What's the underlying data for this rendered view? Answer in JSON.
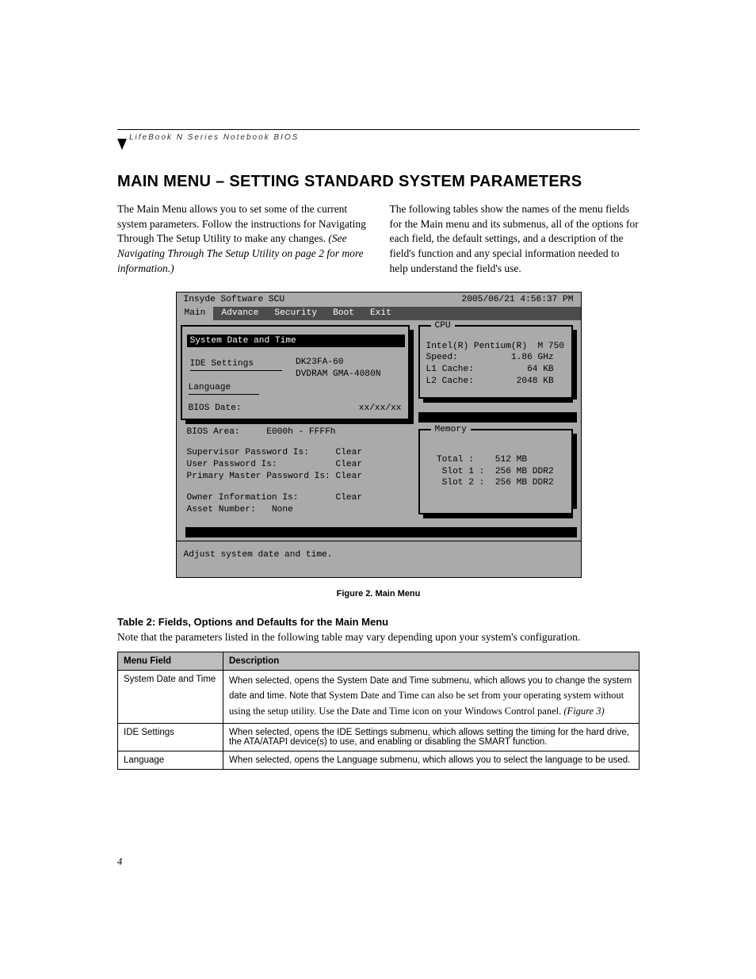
{
  "header": {
    "running_head": "LifeBook N Series Notebook BIOS"
  },
  "title": "MAIN MENU – SETTING STANDARD SYSTEM PARAMETERS",
  "col_left": {
    "p1": "The Main Menu allows you to set some of the current system parameters. Follow the instructions for Navigating Through The Setup Utility to make any changes.",
    "p2": "(See Navigating Through The Setup Utility on page 2 for more information.)"
  },
  "col_right": {
    "p1": "The following tables show the names of the menu fields for the Main menu and its submenus, all of the options for each field, the default settings, and a description of the field's function and any special information needed to help understand the field's use."
  },
  "bios": {
    "title": "Insyde Software SCU",
    "datetime": "2005/06/21  4:56:37  PM",
    "menu": [
      "Main",
      "Advance",
      "Security",
      "Boot",
      "Exit"
    ],
    "left": {
      "item_selected": "System Date and Time",
      "item_ide": "IDE Settings",
      "ide_dev1": "DK23FA-60",
      "ide_dev2": "DVDRAM GMA-4080N",
      "item_lang": "Language",
      "bios_date_lbl": "BIOS Date:",
      "bios_date_val": "xx/xx/xx",
      "bios_area_lbl": "BIOS Area:",
      "bios_area_val": "E000h - FFFFh",
      "supv_lbl": "Supervisor Password Is:",
      "supv_val": "Clear",
      "user_lbl": "User Password Is:",
      "user_val": "Clear",
      "pmast_lbl": "Primary Master Password Is:",
      "pmast_val": "Clear",
      "owner_lbl": "Owner Information Is:",
      "owner_val": "Clear",
      "asset_lbl": "Asset Number:",
      "asset_val": "None"
    },
    "cpu": {
      "label": "CPU",
      "model": "Intel(R) Pentium(R)  M 750",
      "speed_lbl": "Speed:",
      "speed_val": "1.86 GHz",
      "l1_lbl": "L1 Cache:",
      "l1_val": "64 KB",
      "l2_lbl": "L2 Cache:",
      "l2_val": "2048 KB"
    },
    "memory": {
      "label": "Memory",
      "total_lbl": "Total :",
      "total_val": "512 MB",
      "slot1_lbl": "Slot 1 :",
      "slot1_val": "256 MB DDR2",
      "slot2_lbl": "Slot 2 :",
      "slot2_val": "256 MB DDR2"
    },
    "help": "Adjust system date and time."
  },
  "figure_caption": "Figure 2.   Main Menu",
  "table_title": "Table 2: Fields, Options and Defaults for the Main Menu",
  "table_note": "Note that the parameters listed in the following table may vary depending upon your system's configuration.",
  "table": {
    "h1": "Menu Field",
    "h2": "Description",
    "rows": [
      {
        "field": "System Date and Time",
        "desc_a": "When selected, opens the System Date and Time submenu, which allows you to change the system date and time. Note that ",
        "desc_b": "System Date and Time can also be set from your operating system without using the setup utility. Use the Date and Time icon on your Windows Control panel. ",
        "desc_c": "(Figure 3)"
      },
      {
        "field": "IDE Settings",
        "desc_a": "When selected, opens the IDE Settings submenu, which allows setting the timing for the hard drive, the ATA/ATAPI device(s) to use, and enabling or disabling the SMART function.",
        "desc_b": "",
        "desc_c": ""
      },
      {
        "field": "Language",
        "desc_a": "When selected, opens the Language submenu, which allows you to select the language to be used.",
        "desc_b": "",
        "desc_c": ""
      }
    ]
  },
  "page_number": "4"
}
